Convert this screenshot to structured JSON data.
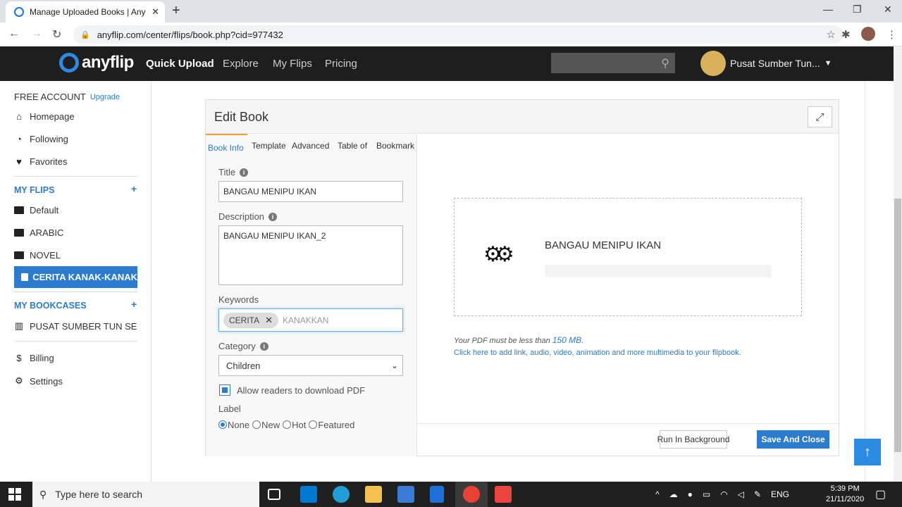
{
  "browser": {
    "tab_title": "Manage Uploaded Books | AnyFli",
    "url": "anyflip.com/center/flips/book.php?cid=977432"
  },
  "site_nav": {
    "logo": "anyflip",
    "links": [
      "Quick Upload",
      "Explore",
      "My Flips",
      "Pricing"
    ],
    "user_name": "Pusat Sumber Tun..."
  },
  "sidebar": {
    "account_type": "FREE ACCOUNT",
    "upgrade": "Upgrade",
    "nav": [
      "Homepage",
      "Following",
      "Favorites"
    ],
    "my_flips_heading": "MY FLIPS",
    "folders": [
      "Default",
      "ARABIC",
      "NOVEL"
    ],
    "active_folder": "CERITA KANAK-KANAK",
    "my_bookcases_heading": "MY BOOKCASES",
    "bookcase": "PUSAT SUMBER TUN SE",
    "billing": "Billing",
    "settings": "Settings"
  },
  "editor": {
    "heading": "Edit Book",
    "tabs": [
      "Book Info",
      "Template",
      "Advanced",
      "Table of",
      "Bookmark"
    ],
    "title_label": "Title",
    "title_value": "BANGAU MENIPU IKAN",
    "description_label": "Description",
    "description_value": "BANGAU MENIPU IKAN_2",
    "keywords_label": "Keywords",
    "keyword_chip": "CERITA",
    "keyword_typing": "KANAKKAN",
    "category_label": "Category",
    "category_value": "Children",
    "allow_download": "Allow readers to download PDF",
    "label_heading": "Label",
    "label_options": [
      "None",
      "New",
      "Hot",
      "Featured"
    ],
    "label_selected": "None"
  },
  "upload": {
    "book_title": "BANGAU MENIPU IKAN",
    "limit_note": "Your PDF must be less than",
    "limit_value": "150 MB.",
    "multimedia_link": "Click here to add link, audio, video, animation and more multimedia to your flipbook.",
    "run_background": "Run In Background",
    "save_close": "Save And Close"
  },
  "taskbar": {
    "search_placeholder": "Type here to search",
    "language": "ENG",
    "time": "5:39 PM",
    "date": "21/11/2020"
  }
}
